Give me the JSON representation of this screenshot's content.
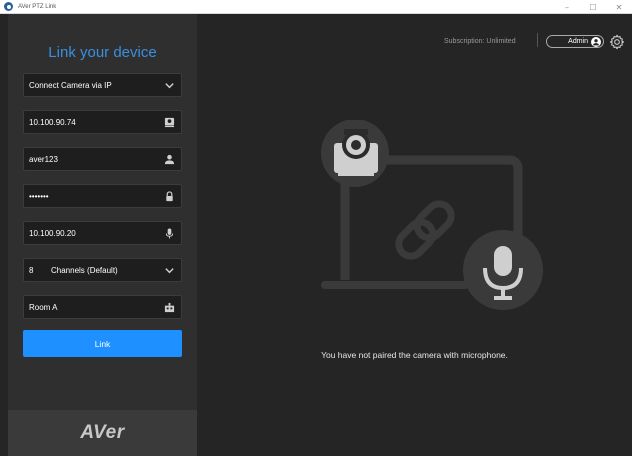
{
  "window": {
    "title": "AVer PTZ Link",
    "minimize": "–",
    "maximize": "☐",
    "close": "✕"
  },
  "sidebar": {
    "heading": "Link your device",
    "connection_mode": "Connect Camera via IP",
    "camera_ip": "10.100.90.74",
    "username": "aver123",
    "password": "•••••••",
    "mic_ip": "10.100.90.20",
    "channels_number": "8",
    "channels_label": "Channels (Default)",
    "room": "Room A",
    "link_label": "Link",
    "logo": "AVer"
  },
  "header": {
    "subscription": "Subscription: Unlimited",
    "admin_label": "Admin"
  },
  "main": {
    "message": "You have not paired the camera with microphone."
  },
  "colors": {
    "accent": "#1e90ff",
    "heading": "#3a8fe0"
  }
}
